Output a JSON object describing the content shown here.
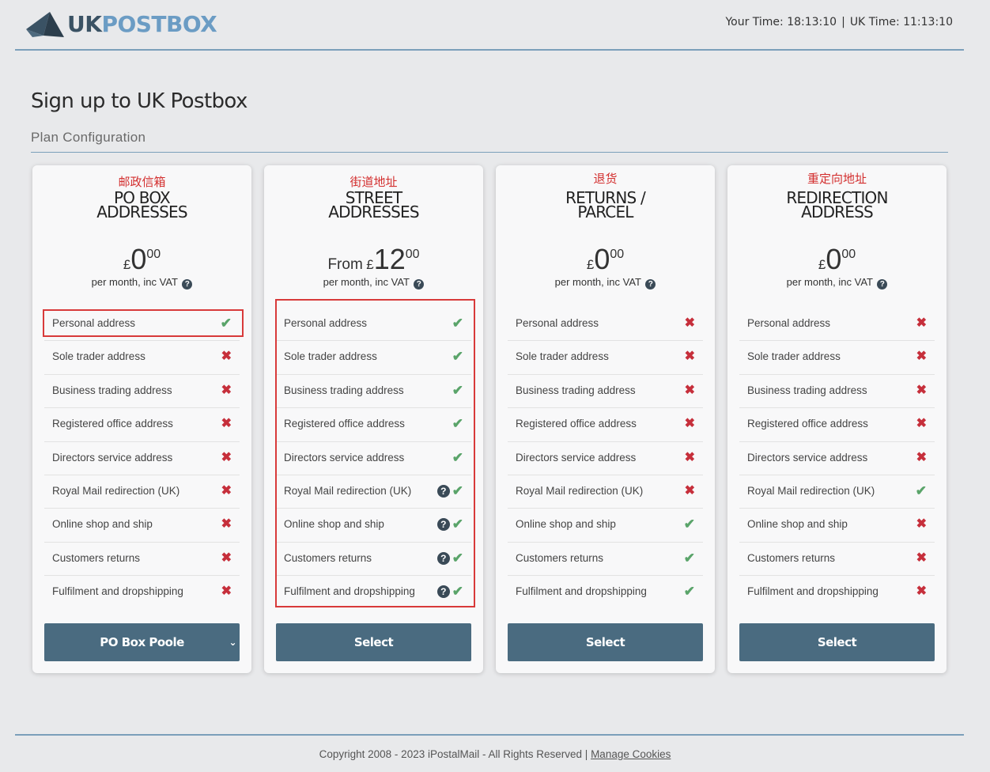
{
  "header": {
    "logo_uk": "UK",
    "logo_postbox": "POSTBOX",
    "your_time": "Your Time: 18:13:10",
    "separator": "|",
    "uk_time": "UK Time: 11:13:10"
  },
  "page": {
    "title": "Sign up to UK Postbox",
    "section": "Plan Configuration"
  },
  "plans": [
    {
      "annotation": "邮政信箱",
      "title_line1": "PO BOX",
      "title_line2": "ADDRESSES",
      "price_prefix": "",
      "currency": "£",
      "price_whole": "0",
      "price_decimal": "00",
      "price_note": "per month, inc VAT",
      "button": "PO Box Poole",
      "button_type": "select-dropdown",
      "features": [
        {
          "label": "Personal address",
          "status": "yes",
          "info": false
        },
        {
          "label": "Sole trader address",
          "status": "no",
          "info": false
        },
        {
          "label": "Business trading address",
          "status": "no",
          "info": false
        },
        {
          "label": "Registered office address",
          "status": "no",
          "info": false
        },
        {
          "label": "Directors service address",
          "status": "no",
          "info": false
        },
        {
          "label": "Royal Mail redirection (UK)",
          "status": "no",
          "info": false
        },
        {
          "label": "Online shop and ship",
          "status": "no",
          "info": false
        },
        {
          "label": "Customers returns",
          "status": "no",
          "info": false
        },
        {
          "label": "Fulfilment and dropshipping",
          "status": "no",
          "info": false
        }
      ]
    },
    {
      "annotation": "街道地址",
      "title_line1": "STREET",
      "title_line2": "ADDRESSES",
      "price_prefix": "From",
      "currency": "£",
      "price_whole": "12",
      "price_decimal": "00",
      "price_note": "per month, inc VAT",
      "button": "Select",
      "button_type": "button",
      "features": [
        {
          "label": "Personal address",
          "status": "yes",
          "info": false
        },
        {
          "label": "Sole trader address",
          "status": "yes",
          "info": false
        },
        {
          "label": "Business trading address",
          "status": "yes",
          "info": false
        },
        {
          "label": "Registered office address",
          "status": "yes",
          "info": false
        },
        {
          "label": "Directors service address",
          "status": "yes",
          "info": false
        },
        {
          "label": "Royal Mail redirection (UK)",
          "status": "yes",
          "info": true
        },
        {
          "label": "Online shop and ship",
          "status": "yes",
          "info": true
        },
        {
          "label": "Customers returns",
          "status": "yes",
          "info": true
        },
        {
          "label": "Fulfilment and dropshipping",
          "status": "yes",
          "info": true
        }
      ]
    },
    {
      "annotation": "退货",
      "title_line1": "RETURNS /",
      "title_line2": "PARCEL",
      "price_prefix": "",
      "currency": "£",
      "price_whole": "0",
      "price_decimal": "00",
      "price_note": "per month, inc VAT",
      "button": "Select",
      "button_type": "button",
      "features": [
        {
          "label": "Personal address",
          "status": "no",
          "info": false
        },
        {
          "label": "Sole trader address",
          "status": "no",
          "info": false
        },
        {
          "label": "Business trading address",
          "status": "no",
          "info": false
        },
        {
          "label": "Registered office address",
          "status": "no",
          "info": false
        },
        {
          "label": "Directors service address",
          "status": "no",
          "info": false
        },
        {
          "label": "Royal Mail redirection (UK)",
          "status": "no",
          "info": false
        },
        {
          "label": "Online shop and ship",
          "status": "yes",
          "info": false
        },
        {
          "label": "Customers returns",
          "status": "yes",
          "info": false
        },
        {
          "label": "Fulfilment and dropshipping",
          "status": "yes",
          "info": false
        }
      ]
    },
    {
      "annotation": "重定向地址",
      "title_line1": "REDIRECTION",
      "title_line2": "ADDRESS",
      "price_prefix": "",
      "currency": "£",
      "price_whole": "0",
      "price_decimal": "00",
      "price_note": "per month, inc VAT",
      "button": "Select",
      "button_type": "button",
      "features": [
        {
          "label": "Personal address",
          "status": "no",
          "info": false
        },
        {
          "label": "Sole trader address",
          "status": "no",
          "info": false
        },
        {
          "label": "Business trading address",
          "status": "no",
          "info": false
        },
        {
          "label": "Registered office address",
          "status": "no",
          "info": false
        },
        {
          "label": "Directors service address",
          "status": "no",
          "info": false
        },
        {
          "label": "Royal Mail redirection (UK)",
          "status": "yes",
          "info": false
        },
        {
          "label": "Online shop and ship",
          "status": "no",
          "info": false
        },
        {
          "label": "Customers returns",
          "status": "no",
          "info": false
        },
        {
          "label": "Fulfilment and dropshipping",
          "status": "no",
          "info": false
        }
      ]
    }
  ],
  "icons": {
    "info": "question-circle-icon",
    "yes": "check-icon",
    "no": "cross-icon",
    "chevron": "chevron-down-icon"
  },
  "colors": {
    "accent_blue": "#7b9fba",
    "button": "#4a6b80",
    "tick": "#5aa46a",
    "cross": "#c62f3b",
    "annotation_red": "#d32f2f"
  },
  "footer": {
    "copyright": "Copyright 2008 - 2023 iPostalMail - All Rights Reserved |",
    "manage_cookies": "Manage Cookies"
  }
}
